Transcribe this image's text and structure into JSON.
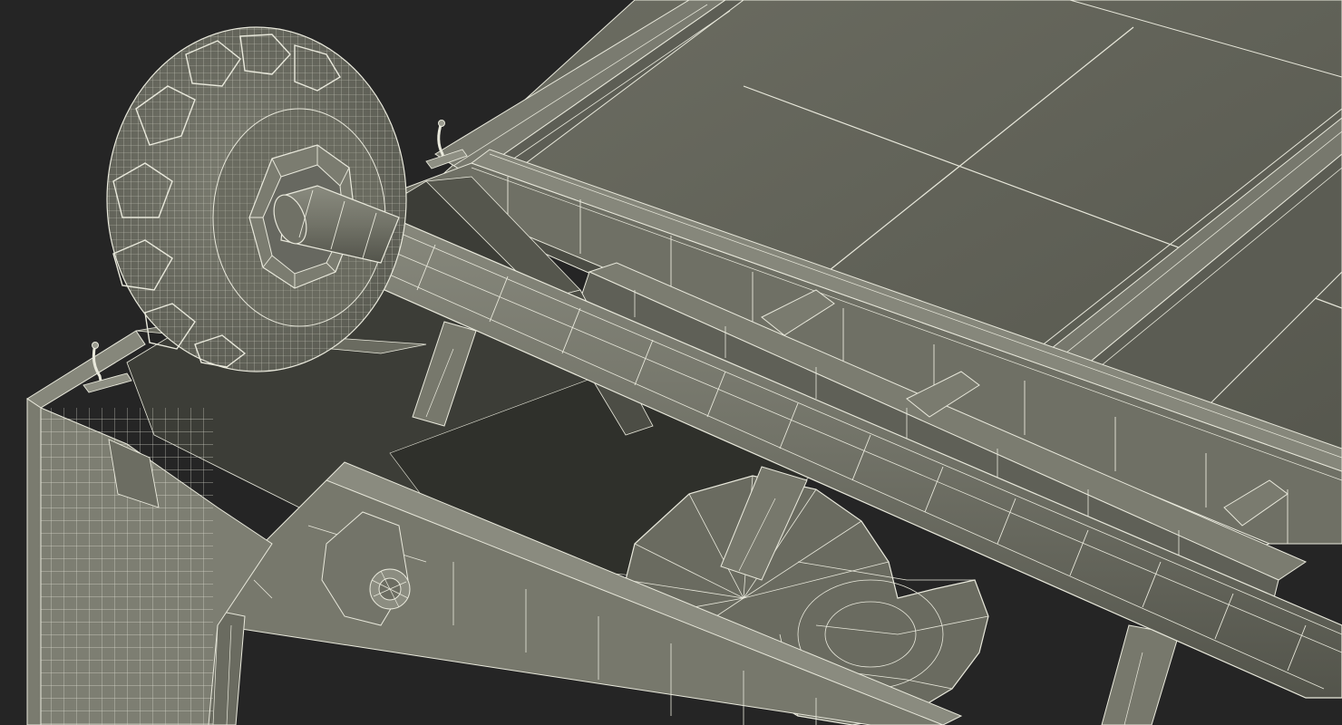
{
  "scene": {
    "subject": "",
    "colors": {
      "background": "#252525",
      "mesh_fill_light": "#7a7a6e",
      "mesh_fill_mid": "#66675c",
      "mesh_fill_dark": "#4a4b43",
      "mesh_fill_deep": "#3a3b35",
      "wire": "#e9e9dc"
    }
  }
}
